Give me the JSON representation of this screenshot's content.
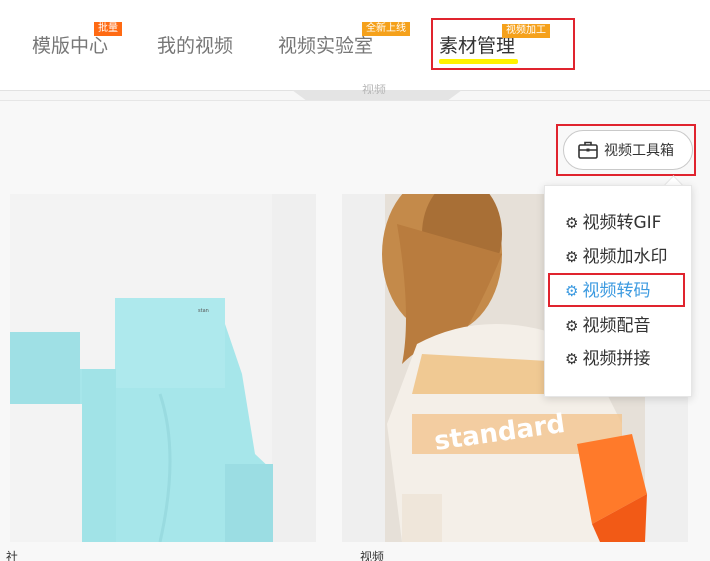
{
  "nav": {
    "items": [
      {
        "label": "模版中心",
        "badge": "批量"
      },
      {
        "label": "我的视频",
        "badge": ""
      },
      {
        "label": "视频实验室",
        "badge": "全新上线"
      },
      {
        "label": "素材管理",
        "badge": "视频加工"
      }
    ],
    "tab_label": "视频"
  },
  "toolbox": {
    "label": "视频工具箱",
    "menu": [
      {
        "label": "视频转GIF"
      },
      {
        "label": "视频加水印"
      },
      {
        "label": "视频转码"
      },
      {
        "label": "视频配音"
      },
      {
        "label": "视频拼接"
      }
    ]
  },
  "cards": [
    {
      "caption": "社"
    },
    {
      "caption": "视频"
    }
  ],
  "colors": {
    "accent_blue": "#3c9ae0",
    "badge_orange": "#ff6a13",
    "badge_amber": "#f5a11b",
    "highlight_red": "#e0242e",
    "underline_yellow": "#fff200"
  }
}
